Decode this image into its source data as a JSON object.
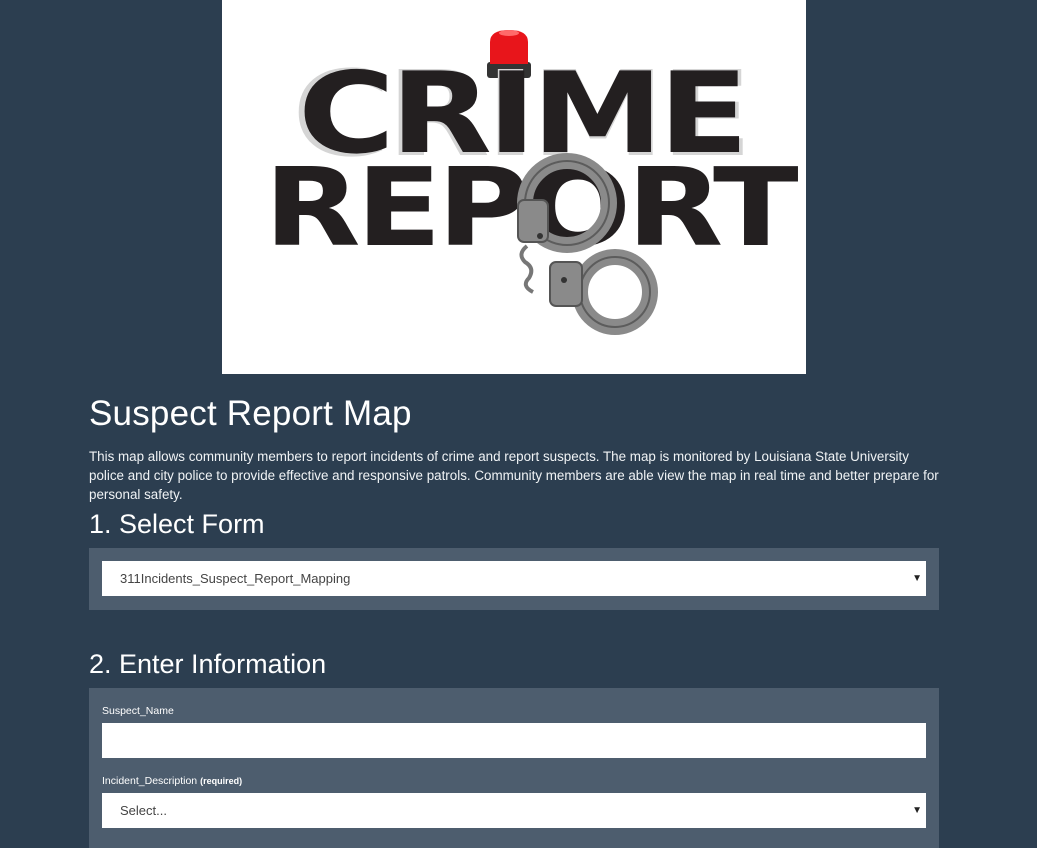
{
  "banner": {
    "logo_text_line1": "CRIME",
    "logo_text_line2": "REPORT",
    "siren_color": "#e8151b",
    "letter_color": "#231f20",
    "cuff_color": "#8a8a8a"
  },
  "page": {
    "title": "Suspect Report Map",
    "description": "This map allows community members to report incidents of crime and report suspects. The map is monitored by Louisiana State University police and city police to provide effective and responsive patrols. Community members are able view the map in real time and better prepare for personal safety."
  },
  "step1": {
    "title": "1. Select Form",
    "selected_form": "311Incidents_Suspect_Report_Mapping"
  },
  "step2": {
    "title": "2. Enter Information",
    "suspect_name_label": "Suspect_Name",
    "suspect_name_value": "",
    "incident_description_label": "Incident_Description",
    "required_label": "(required)",
    "incident_description_value": "Select..."
  },
  "colors": {
    "background": "#2c3e50",
    "panel": "#4d5d6e"
  }
}
